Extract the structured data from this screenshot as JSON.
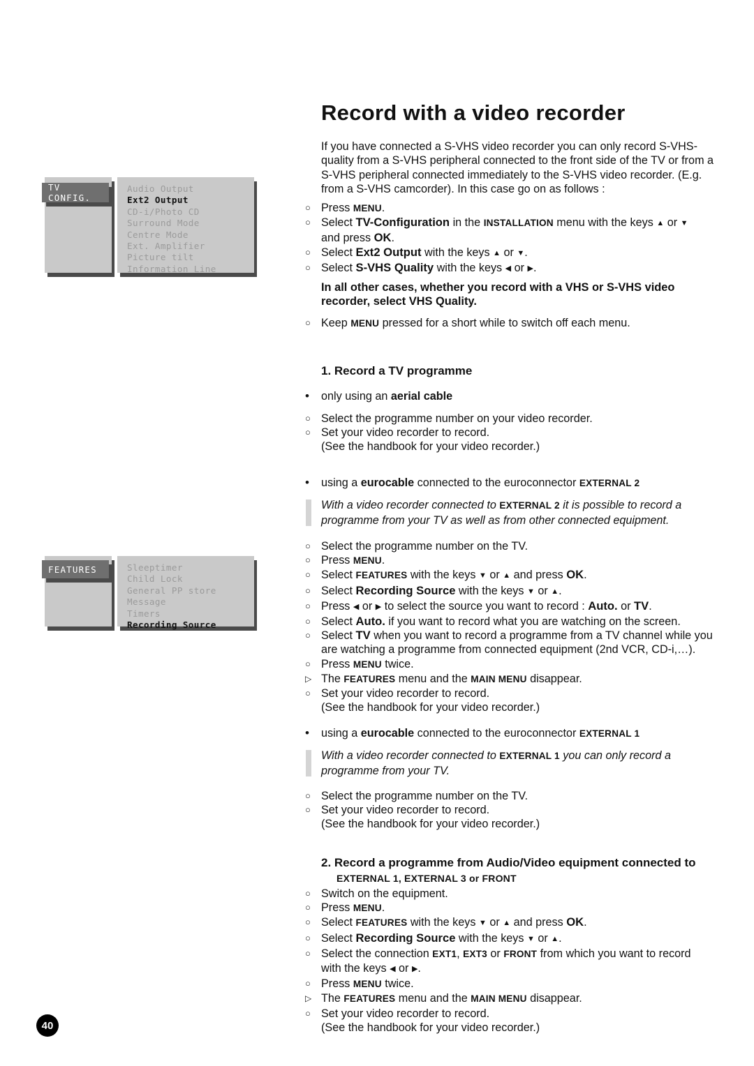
{
  "page": {
    "number": "40",
    "title": "Record with a video recorder"
  },
  "intro": {
    "text": "If you have connected a S-VHS video recorder you can only record S-VHS-quality from a S-VHS peripheral connected to the front side of the TV or from a S-VHS peripheral connected immediately to the S-VHS video recorder. (E.g. from a S-VHS camcorder). In this case go on as follows :"
  },
  "steps_top": [
    {
      "marker": "circle",
      "html": "Press <span class='sc'>MENU</span>."
    },
    {
      "marker": "circle",
      "html": "Select <b class='bigb'>TV-Configuration</b> in the <span class='sc'>INSTALLATION</span> menu with the keys <span class='arrow'>&#9650;</span> or <span class='arrow'>&#9660;</span>"
    },
    {
      "marker": "none",
      "html": "and press <b class='bigb'>OK</b>."
    },
    {
      "marker": "circle",
      "html": "Select <b class='bigb'>Ext2 Output</b> with the keys <span class='arrow'>&#9650;</span> or <span class='arrow'>&#9660;</span>."
    },
    {
      "marker": "circle",
      "html": "Select <b class='bigb'>S-VHS Quality</b> with the keys <span class='arrow'>&#9664;</span> or <span class='arrow'>&#9654;</span>."
    }
  ],
  "callout": {
    "text": "In all other cases, whether you record with a VHS or S-VHS video recorder, select VHS Quality."
  },
  "steps_after_callout": [
    {
      "marker": "circle",
      "html": "Keep <span class='sc'>MENU</span> pressed for a short while to switch off each menu."
    }
  ],
  "section1": {
    "heading": "1. Record a TV programme",
    "sub_aerial": {
      "bullet_html": "only using an <b>aerial cable</b>",
      "steps": [
        {
          "marker": "circle",
          "html": "Select the programme number on your video recorder."
        },
        {
          "marker": "circle",
          "html": "Set your video recorder to record."
        },
        {
          "marker": "none",
          "html": "(See the handbook for your video recorder.)"
        }
      ]
    },
    "sub_ext2": {
      "bullet_html": "using a <b>eurocable</b> connected to the euroconnector <span class='sc'>EXTERNAL 2</span>",
      "note_html": "With a video recorder connected to <span class='sc'>EXTERNAL 2</span> it is possible to record a programme from your TV as well as from other connected equipment.",
      "steps": [
        {
          "marker": "circle",
          "html": "Select the programme number on the TV."
        },
        {
          "marker": "circle",
          "html": "Press <span class='sc'>MENU</span>."
        },
        {
          "marker": "circle",
          "html": "Select <span class='sc'>FEATURES</span> with the keys <span class='arrow'>&#9660;</span> or <span class='arrow'>&#9650;</span> and press <b class='bigb'>OK</b>."
        },
        {
          "marker": "circle",
          "html": "Select <b class='bigb'>Recording Source</b> with the keys <span class='arrow'>&#9660;</span> or <span class='arrow'>&#9650;</span>."
        },
        {
          "marker": "circle",
          "html": "Press <span class='arrow'>&#9664;</span> or <span class='arrow'>&#9654;</span> to select the source you want to record : <b class='bigb'>Auto.</b> or <b class='bigb'>TV</b>."
        },
        {
          "marker": "circle",
          "html": "Select <b class='bigb'>Auto.</b> if you want to record what you are watching on the screen."
        },
        {
          "marker": "circle",
          "html": "Select <b class='bigb'>TV</b> when you want to record a programme from a TV channel while you"
        },
        {
          "marker": "none",
          "html": "are watching a programme from connected equipment (2nd VCR, CD-i,&#8230;)."
        },
        {
          "marker": "circle",
          "html": "Press <span class='sc'>MENU</span> twice."
        },
        {
          "marker": "triangle",
          "html": "The <span class='sc'>FEATURES</span> menu and the <span class='sc'>MAIN MENU</span> disappear."
        },
        {
          "marker": "circle",
          "html": "Set your video recorder to record."
        },
        {
          "marker": "none",
          "html": "(See the handbook for your video recorder.)"
        }
      ]
    },
    "sub_ext1": {
      "bullet_html": "using a <b>eurocable</b> connected to the euroconnector <span class='sc'>EXTERNAL 1</span>",
      "note_html": "With a video recorder connected to <span class='sc'>EXTERNAL 1</span> you can only record a programme from your TV.",
      "steps": [
        {
          "marker": "circle",
          "html": "Select the programme number on the TV."
        },
        {
          "marker": "circle",
          "html": "Set your video recorder to record."
        },
        {
          "marker": "none",
          "html": "(See the handbook for your video recorder.)"
        }
      ]
    }
  },
  "section2": {
    "heading": "2. Record a programme from Audio/Video equipment connected to",
    "subheading": "EXTERNAL 1, EXTERNAL 3 or FRONT",
    "steps": [
      {
        "marker": "circle",
        "html": "Switch on the equipment."
      },
      {
        "marker": "circle",
        "html": "Press <span class='sc'>MENU</span>."
      },
      {
        "marker": "circle",
        "html": "Select <span class='sc'>FEATURES</span> with the keys <span class='arrow'>&#9660;</span> or <span class='arrow'>&#9650;</span> and press <b class='bigb'>OK</b>."
      },
      {
        "marker": "circle",
        "html": "Select <b class='bigb'>Recording Source</b> with the keys <span class='arrow'>&#9660;</span> or <span class='arrow'>&#9650;</span>."
      },
      {
        "marker": "circle",
        "html": "Select the connection <span class='sc'>EXT1</span>, <span class='sc'>EXT3</span> or <span class='sc'>FRONT</span> from which you want to record"
      },
      {
        "marker": "none",
        "html": "with the keys <span class='arrow'>&#9664;</span> or <span class='arrow'>&#9654;</span>."
      },
      {
        "marker": "circle",
        "html": "Press <span class='sc'>MENU</span> twice."
      },
      {
        "marker": "triangle",
        "html": "The <span class='sc'>FEATURES</span> menu and the <span class='sc'>MAIN MENU</span> disappear."
      },
      {
        "marker": "circle",
        "html": "Set your video recorder to record."
      },
      {
        "marker": "none",
        "html": "(See the handbook for your video recorder.)"
      }
    ]
  },
  "osd_menus": [
    {
      "id": "tv-config",
      "tab_label": "TV CONFIG.",
      "items": [
        {
          "label": "Audio Output",
          "selected": false
        },
        {
          "label": "Ext2 Output",
          "selected": true
        },
        {
          "label": "CD-i/Photo CD",
          "selected": false
        },
        {
          "label": "Surround Mode",
          "selected": false
        },
        {
          "label": "Centre Mode",
          "selected": false
        },
        {
          "label": "Ext. Amplifier",
          "selected": false
        },
        {
          "label": "Picture tilt",
          "selected": false
        },
        {
          "label": "Information Line",
          "selected": false
        }
      ]
    },
    {
      "id": "features",
      "tab_label": "FEATURES",
      "items": [
        {
          "label": "Sleeptimer",
          "selected": false
        },
        {
          "label": "Child Lock",
          "selected": false
        },
        {
          "label": "General PP store",
          "selected": false
        },
        {
          "label": "Message",
          "selected": false
        },
        {
          "label": "Timers",
          "selected": false
        },
        {
          "label": "Recording Source",
          "selected": true
        }
      ]
    }
  ],
  "colors": {
    "osd_panel": "#c9c9c9",
    "osd_tab": "#6f6f6f",
    "osd_shadow": "#4a4a4a",
    "osd_item_dim": "#9b9b9b",
    "osd_item_selected": "#111111",
    "note_bar": "#d4d4d4",
    "page_badge": "#000000"
  },
  "markers": {
    "circle": "○",
    "dot": "•",
    "triangle": "▷"
  }
}
